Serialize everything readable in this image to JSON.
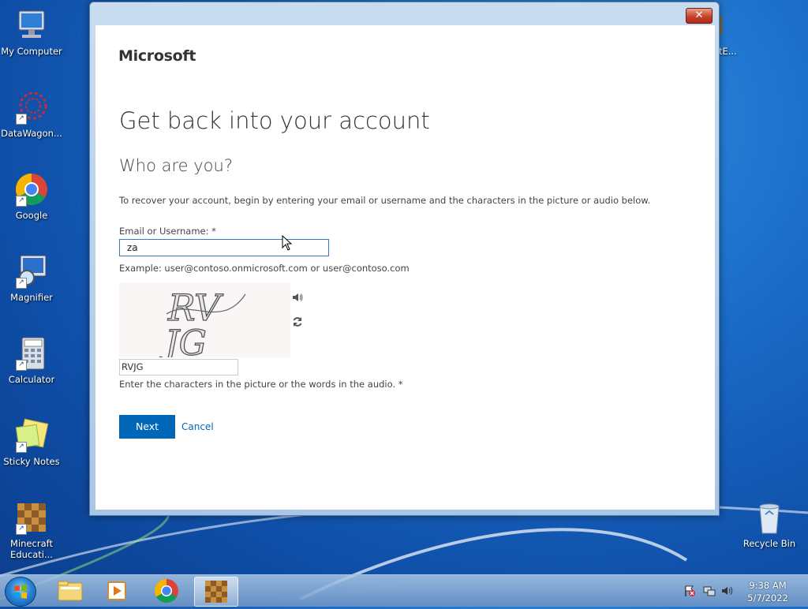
{
  "desktop": {
    "icons": [
      {
        "label": "My Computer"
      },
      {
        "label": "DataWagon..."
      },
      {
        "label": "Google"
      },
      {
        "label": "Magnifier"
      },
      {
        "label": "Calculator"
      },
      {
        "label": "Sticky Notes"
      },
      {
        "label": "Minecraft Educati..."
      },
      {
        "label": "Recycle Bin"
      },
      {
        "label": "tE..."
      }
    ]
  },
  "window": {
    "close_label": "✕"
  },
  "page": {
    "logo": "Microsoft",
    "title": "Get back into your account",
    "subtitle": "Who are you?",
    "intro": "To recover your account, begin by entering your email or username and the characters in the picture or audio below.",
    "email_label": "Email or Username: *",
    "email_value": "za",
    "example": "Example: user@contoso.onmicrosoft.com or user@contoso.com",
    "captcha_text": "RVJG",
    "captcha_value": "RVJG",
    "captcha_hint": "Enter the characters in the picture or the words in the audio. *",
    "next_label": "Next",
    "cancel_label": "Cancel"
  },
  "taskbar": {
    "time": "9:38 AM",
    "date": "5/7/2022"
  },
  "colors": {
    "accent": "#0067b8",
    "close": "#c7432c"
  }
}
